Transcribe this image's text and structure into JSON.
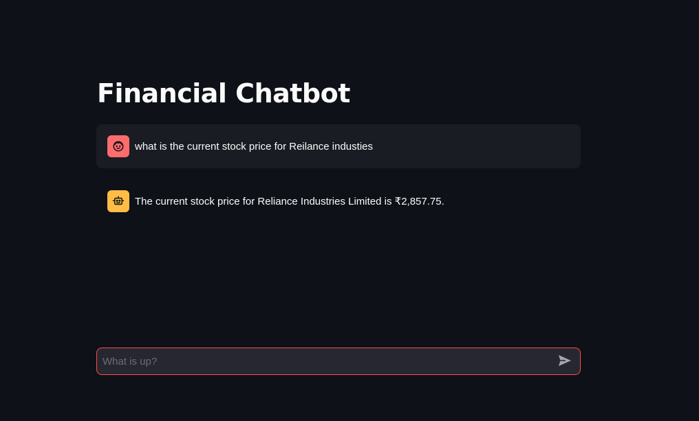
{
  "header": {
    "title": "Financial Chatbot"
  },
  "messages": [
    {
      "role": "user",
      "avatar_icon": "user-face-icon",
      "avatar_color": "#ff6c6c",
      "text": "what is the current stock price for Reilance industies"
    },
    {
      "role": "assistant",
      "avatar_icon": "robot-icon",
      "avatar_color": "#ffbd45",
      "text": "The current stock price for Reliance Industries Limited is ₹2,857.75."
    }
  ],
  "chat_input": {
    "placeholder": "What is up?",
    "value": "",
    "border_color": "#ff4b4b",
    "send_icon": "send-icon"
  },
  "theme": {
    "background": "#0e1117",
    "user_message_bg": "#1a1c24",
    "input_bg": "#262730"
  }
}
